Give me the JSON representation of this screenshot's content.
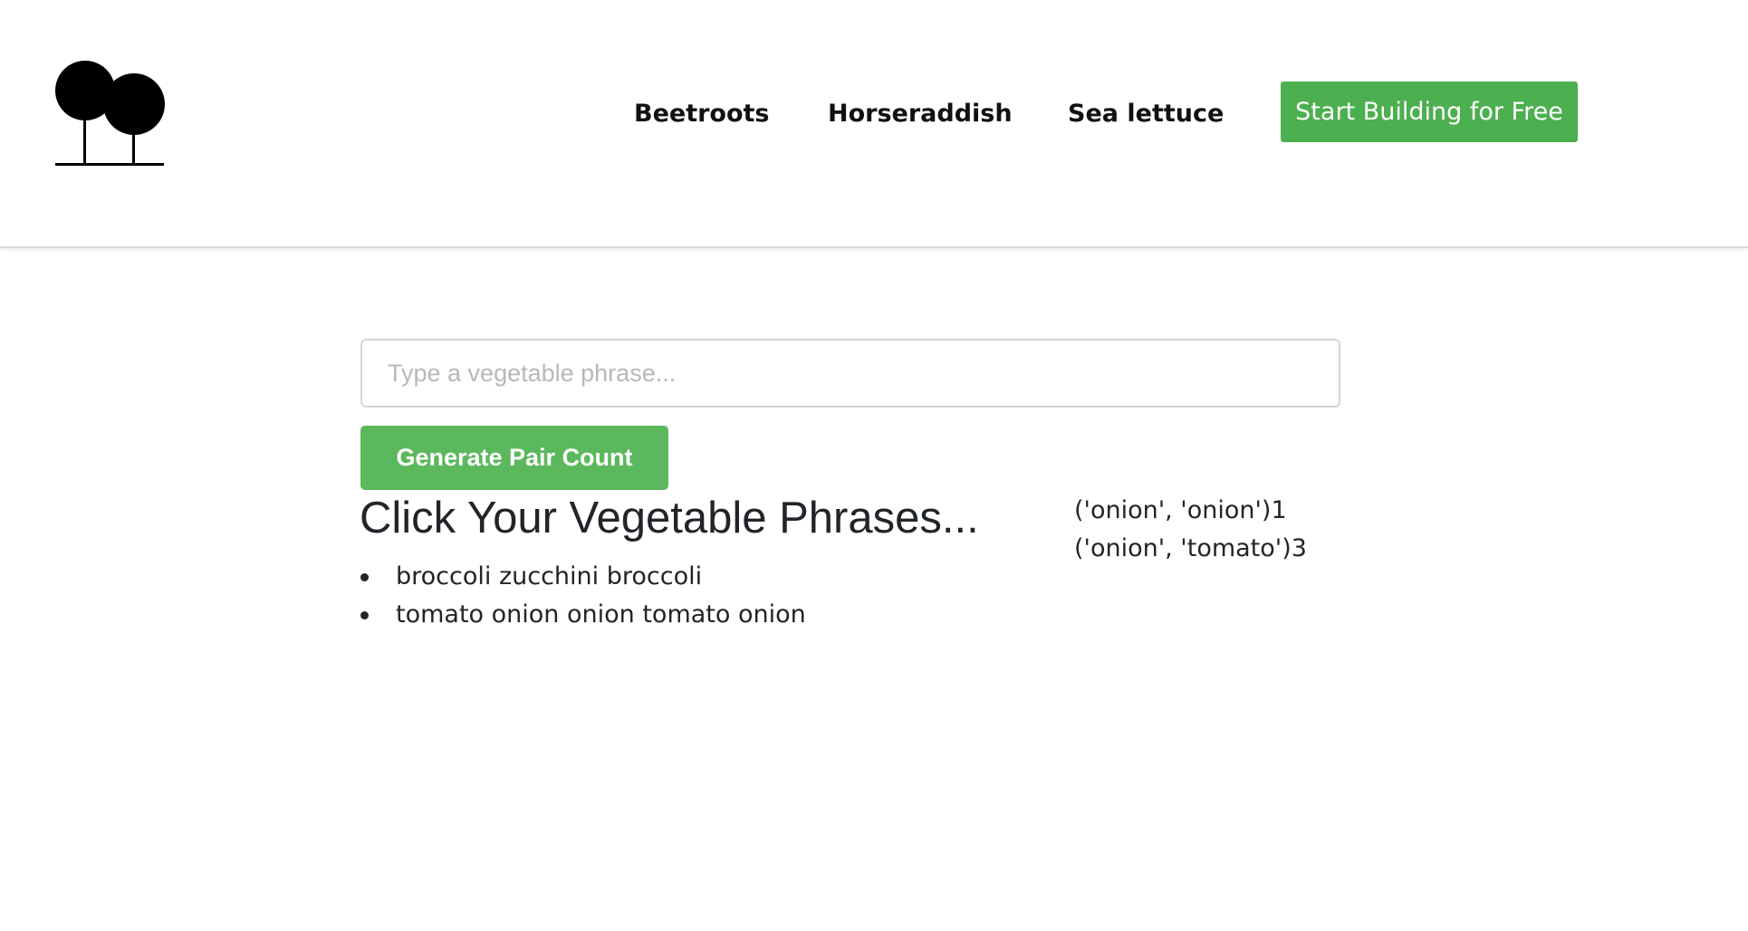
{
  "header": {
    "logo_icon": "two-trees-logo-icon",
    "nav": [
      {
        "label": "Beetroots"
      },
      {
        "label": "Horseraddish"
      },
      {
        "label": "Sea lettuce"
      }
    ],
    "cta_label": "Start Building for Free",
    "cta_color": "#4caf50"
  },
  "main": {
    "input": {
      "value": "",
      "placeholder": "Type a vegetable phrase..."
    },
    "generate_label": "Generate Pair Count",
    "generate_color": "#5cb85c",
    "heading": "Click Your Vegetable Phrases...",
    "phrases": [
      {
        "text": "broccoli zucchini broccoli"
      },
      {
        "text": "tomato onion onion tomato onion"
      }
    ],
    "pairs": [
      {
        "pair": "('onion', 'onion')",
        "count": "1"
      },
      {
        "pair": "('onion', 'tomato')",
        "count": "3"
      }
    ]
  }
}
